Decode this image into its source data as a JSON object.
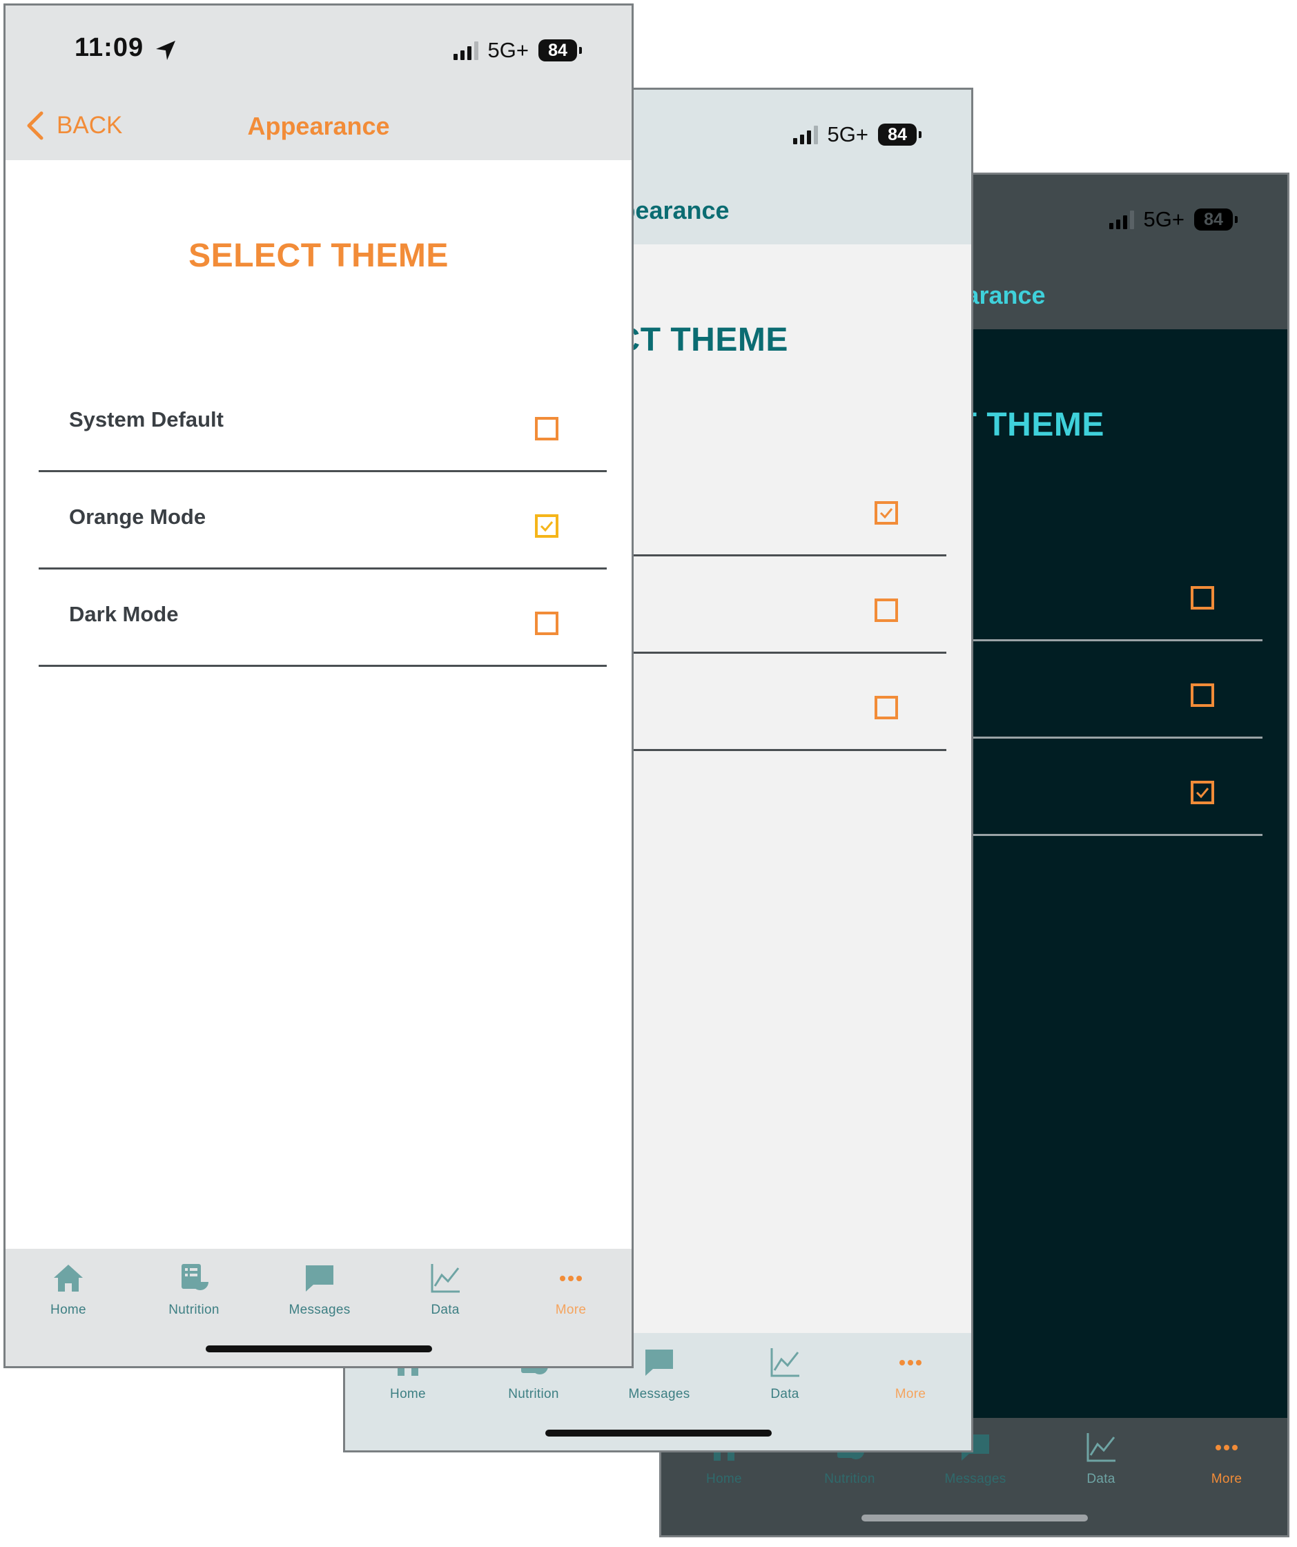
{
  "status": {
    "time": "11:09",
    "network": "5G+",
    "battery": "84"
  },
  "nav": {
    "back_label": "BACK",
    "title": "Appearance"
  },
  "section_title": "SELECT THEME",
  "options": [
    {
      "label": "System Default"
    },
    {
      "label": "Orange Mode"
    },
    {
      "label": "Dark Mode"
    }
  ],
  "tabs": [
    {
      "label": "Home",
      "icon": "home-icon"
    },
    {
      "label": "Nutrition",
      "icon": "nutrition-icon"
    },
    {
      "label": "Messages",
      "icon": "messages-icon"
    },
    {
      "label": "Data",
      "icon": "data-chart-icon"
    },
    {
      "label": "More",
      "icon": "more-icon"
    }
  ],
  "screens": {
    "orange": {
      "selected_option": "Orange Mode",
      "colors": {
        "accent": "#f28c38",
        "title": "#f28c38",
        "checkmark": "#f5b51a",
        "background": "#ffffff",
        "bars": "#e2e4e5",
        "icons": "#6ea4a4"
      }
    },
    "system_default": {
      "selected_option": "System Default",
      "colors": {
        "title": "#0b6c72",
        "background": "#f2f2f2",
        "bars": "#dce4e6",
        "checkbox": "#f28c38"
      }
    },
    "dark": {
      "selected_option": "Dark Mode",
      "colors": {
        "title": "#3fd1db",
        "background": "#011e23",
        "bars": "#414a4d",
        "checkbox": "#f28c38"
      }
    }
  }
}
